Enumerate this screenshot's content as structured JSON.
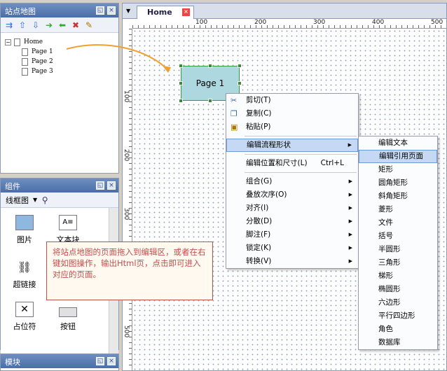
{
  "sitemap": {
    "title": "站点地图",
    "tree": {
      "root": "Home",
      "pages": [
        "Page 1",
        "Page 2",
        "Page 3"
      ]
    }
  },
  "widgets": {
    "title": "组件",
    "library": "线框图",
    "items": [
      {
        "label": "图片",
        "icon": "image-icon"
      },
      {
        "label": "文本块",
        "icon": "text-block-icon"
      },
      {
        "label": "超链接",
        "icon": "link-icon"
      },
      {
        "label": "占位符",
        "icon": "placeholder-icon"
      },
      {
        "label": "按钮",
        "icon": "button-icon"
      }
    ]
  },
  "masters": {
    "title": "模块"
  },
  "editor": {
    "tab": "Home",
    "ruler_h": [
      "100",
      "200",
      "300",
      "400",
      "500"
    ],
    "ruler_v": [
      "100",
      "200",
      "300",
      "400",
      "500"
    ],
    "shape_label": "Page 1"
  },
  "context_menu": {
    "items": [
      {
        "label": "剪切(T)",
        "icon": "cut-icon"
      },
      {
        "label": "复制(C)",
        "icon": "copy-icon"
      },
      {
        "label": "粘贴(P)",
        "icon": "paste-icon"
      },
      {
        "label": "编辑流程形状",
        "submenu": true
      },
      {
        "label": "编辑位置和尺寸(L)",
        "shortcut": "Ctrl+L"
      },
      {
        "label": "组合(G)",
        "submenu": true
      },
      {
        "label": "叠放次序(O)",
        "submenu": true
      },
      {
        "label": "对齐(I)",
        "submenu": true
      },
      {
        "label": "分散(D)",
        "submenu": true
      },
      {
        "label": "脚注(F)",
        "submenu": true
      },
      {
        "label": "锁定(K)",
        "submenu": true
      },
      {
        "label": "转换(V)",
        "submenu": true
      }
    ]
  },
  "submenu": {
    "items": [
      "编辑文本",
      "编辑引用页面",
      "矩形",
      "圆角矩形",
      "斜角矩形",
      "菱形",
      "文件",
      "括号",
      "半圆形",
      "三角形",
      "梯形",
      "椭圆形",
      "六边形",
      "平行四边形",
      "角色",
      "数据库"
    ],
    "highlighted": "编辑引用页面"
  },
  "callout": {
    "text": "将站点地图的页面拖入到编辑区，或者在右键如图操作，输出Html页，点击即可进入对应的页面。"
  },
  "colors": {
    "accent": "#c0504d",
    "title_bar": "#4a6ea8",
    "shape_fill": "#add8df",
    "arrow": "#f0a030"
  }
}
